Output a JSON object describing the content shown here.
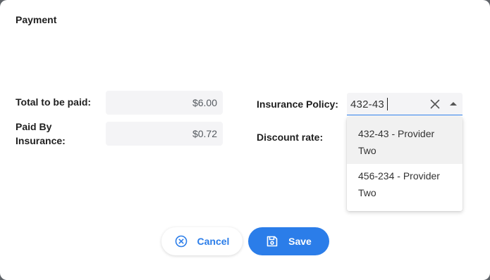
{
  "dialog": {
    "title": "Payment"
  },
  "fields": {
    "total_label": "Total to be paid:",
    "total_value": "$6.00",
    "paid_label_line1": "Paid By",
    "paid_label_line2": "Insurance:",
    "paid_value": "$0.72",
    "insurance_label": "Insurance Policy:",
    "insurance_input_value": "432-43",
    "discount_label": "Discount rate:"
  },
  "dropdown": {
    "options": [
      {
        "line1": "432-43 - Provider",
        "line2": "Two"
      },
      {
        "line1": "456-234 - Provider",
        "line2": "Two"
      }
    ],
    "highlighted_index": 0
  },
  "buttons": {
    "cancel_label": "Cancel",
    "save_label": "Save"
  },
  "icons": {
    "clear": "close-icon",
    "dropdown_arrow": "triangle-up-icon",
    "cancel": "circle-x-icon",
    "save": "floppy-disk-icon"
  },
  "colors": {
    "accent": "#2b7de9",
    "field_background": "#f4f4f6",
    "highlight_background": "#f1f1f1"
  }
}
